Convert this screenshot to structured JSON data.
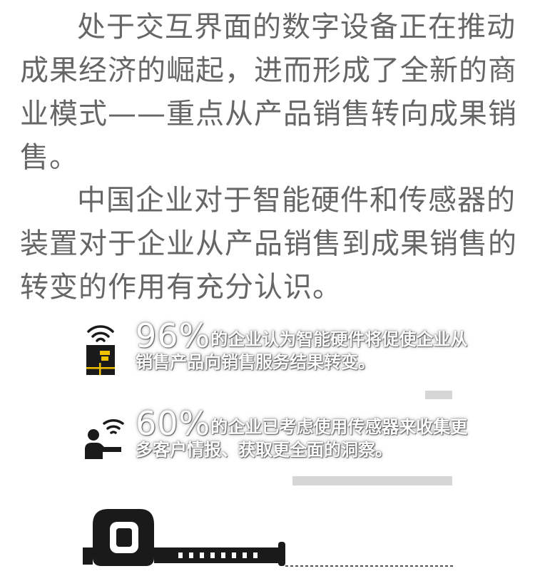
{
  "paragraphs": [
    "处于交互界面的数字设备正在推动成果经济的崛起，进而形成了全新的商业模式——重点从产品销售转向成果销售。",
    "中国企业对于智能硬件和传感器的装置对于企业从产品销售到成果销售的转变的作用有充分认识。"
  ],
  "stats": [
    {
      "value": "96%",
      "text": "的企业认为智能硬件将促使企业从销售产品向销售服务结果转变。",
      "icon": "wifi-device-icon"
    },
    {
      "value": "60%",
      "text": "的企业已考虑使用传感器来收集更多客户情报、获取更全面的洞察。",
      "icon": "wifi-person-icon"
    }
  ],
  "colors": {
    "body_text": "#666666",
    "icon_dark": "#1a1a1a",
    "icon_accent": "#f2c200",
    "bar_gray": "#d6d6d6"
  }
}
